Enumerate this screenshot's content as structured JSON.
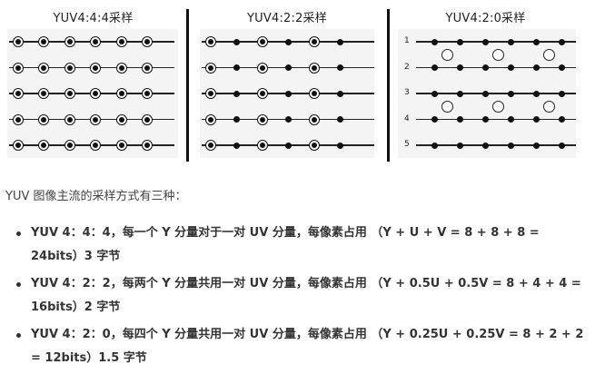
{
  "figure": {
    "panels": [
      {
        "title": "YUV4:4:4采样",
        "pattern": "444",
        "rows": 5,
        "cols": 6
      },
      {
        "title": "YUV4:2:2采样",
        "pattern": "422",
        "rows": 5,
        "cols": 6
      },
      {
        "title": "YUV4:2:0采样",
        "pattern": "420",
        "rows": 5,
        "cols": 6,
        "row_labels": [
          "1",
          "2",
          "3",
          "4",
          "5"
        ]
      }
    ]
  },
  "intro": "YUV 图像主流的采样方式有三种：",
  "bullets": [
    {
      "line1": "YUV 4：4：4，每一个 Y 分量对于一对 UV 分量，每像素占用 （Y + U + V = 8 + 8 + 8 =",
      "line2": "24bits）3 字节"
    },
    {
      "line1": "YUV 4：2：2，每两个 Y 分量共用一对 UV 分量，每像素占用 （Y + 0.5U + 0.5V = 8 + 4 + 4 =",
      "line2": "16bits）2 字节"
    },
    {
      "line1": "YUV 4：2：0，每四个 Y 分量共用一对 UV 分量，每像素占用 （Y + 0.25U + 0.25V = 8 + 2 + 2",
      "line2": "= 12bits）1.5 字节"
    }
  ]
}
